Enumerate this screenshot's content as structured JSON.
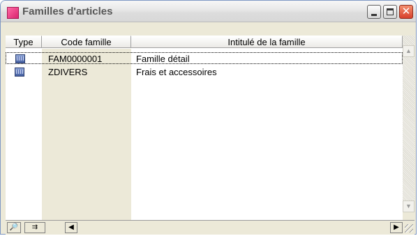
{
  "window": {
    "title": "Familles d'articles"
  },
  "table": {
    "headers": {
      "type": "Type",
      "code": "Code famille",
      "intitule": "Intitulé de la famille"
    },
    "rows": [
      {
        "type_icon": "family-type-icon",
        "code": "FAM0000001",
        "intitule": "Famille détail",
        "selected": true
      },
      {
        "type_icon": "family-type-icon",
        "code": "ZDIVERS",
        "intitule": "Frais et accessoires",
        "selected": false
      }
    ]
  },
  "toolbar": {
    "zoom_icon": "zoom-icon",
    "export_icon": "export-icon"
  },
  "colors": {
    "title_bar": "#dcdcdc",
    "close_button": "#d7402b",
    "app_icon": "#e0357c",
    "code_column_bg": "#ece9d8"
  }
}
